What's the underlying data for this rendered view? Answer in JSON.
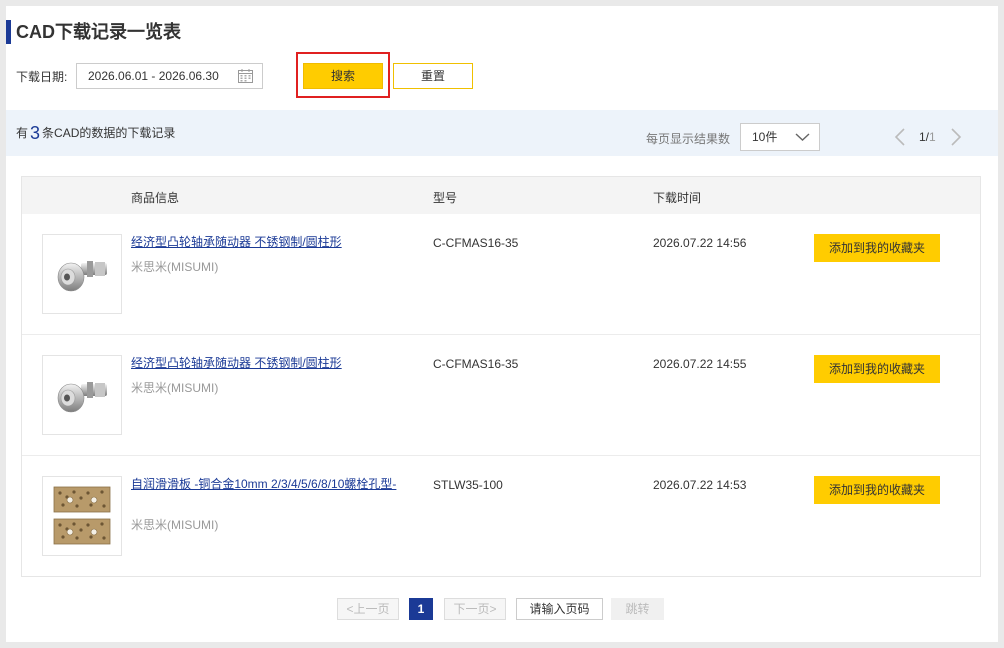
{
  "page": {
    "title": "CAD下载记录一览表"
  },
  "filter": {
    "date_label": "下载日期:",
    "date_range": "2026.06.01 - 2026.06.30",
    "search_label": "搜索",
    "reset_label": "重置"
  },
  "summary": {
    "prefix": "有",
    "count": "3",
    "suffix": "条CAD的数据的下载记录",
    "per_page_label": "每页显示结果数",
    "per_page_value": "10件",
    "page_current": "1/",
    "page_total": "1"
  },
  "table": {
    "headers": {
      "product": "商品信息",
      "model": "型号",
      "time": "下载时间"
    },
    "rows": [
      {
        "name": "经济型凸轮轴承随动器 不锈钢制/圆柱形",
        "brand": "米思米(MISUMI)",
        "model": "C-CFMAS16-35",
        "time": "2026.07.22 14:56",
        "action": "添加到我的收藏夹",
        "thumb_icon": "cam-follower-image"
      },
      {
        "name": "经济型凸轮轴承随动器 不锈钢制/圆柱形",
        "brand": "米思米(MISUMI)",
        "model": "C-CFMAS16-35",
        "time": "2026.07.22 14:55",
        "action": "添加到我的收藏夹",
        "thumb_icon": "cam-follower-image"
      },
      {
        "name": "自润滑滑板 -铜合金10mm 2/3/4/5/6/8/10螺栓孔型-",
        "brand": "米思米(MISUMI)",
        "model": "STLW35-100",
        "time": "2026.07.22 14:53",
        "action": "添加到我的收藏夹",
        "thumb_icon": "slide-plate-image"
      }
    ]
  },
  "pager": {
    "prev_label": "<上一页",
    "current": "1",
    "next_label": "下一页>",
    "input_placeholder": "请输入页码",
    "go_label": "跳转"
  },
  "colors": {
    "accent": "#ffcc00",
    "brand": "#1b3a96",
    "highlight": "#e02020",
    "info_bar": "#edf3fa"
  }
}
